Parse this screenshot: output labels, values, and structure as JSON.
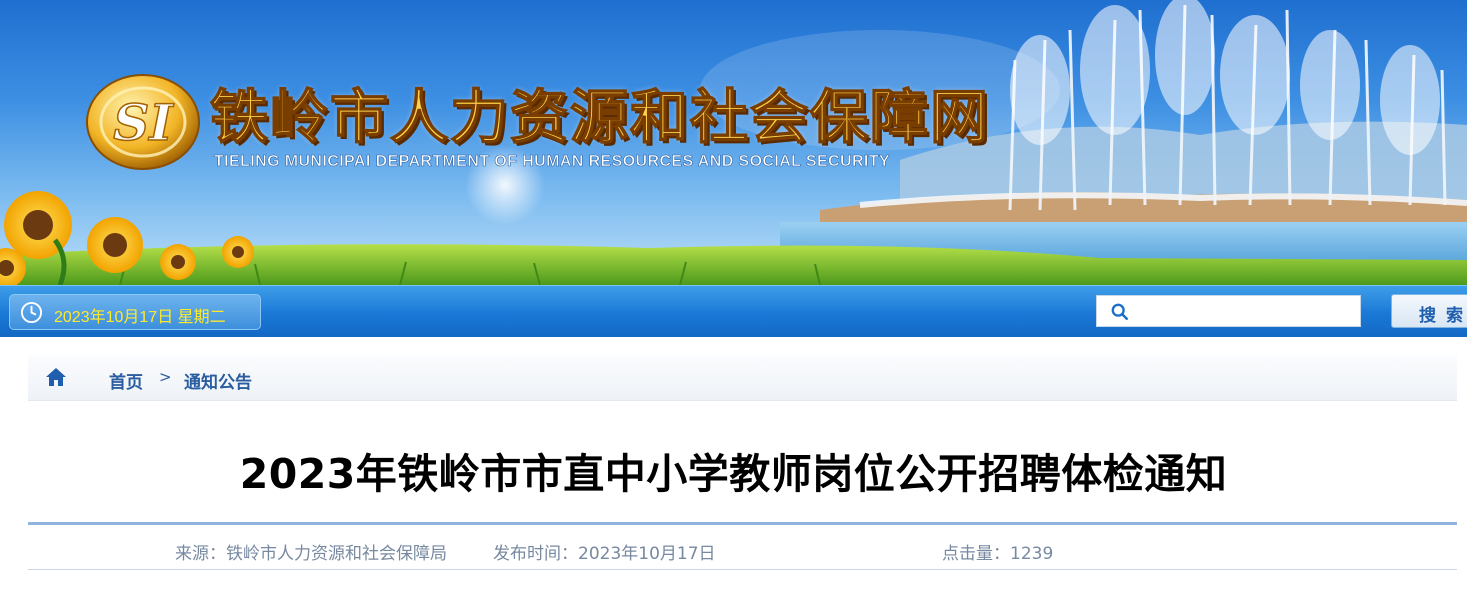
{
  "header": {
    "site_title": "铁岭市人力资源和社会保障网",
    "site_subtitle": "TIELING MUNICIPAI DEPARTMENT OF HUMAN RESOURCES AND SOCIAL SECURITY",
    "logo_text": "SI",
    "icons": {
      "logo": "si-emblem-icon"
    }
  },
  "toolbar": {
    "date_text": "2023年10月17日 星期二",
    "search_placeholder": "",
    "search_value": "",
    "search_button_label": "搜索",
    "icons": {
      "clock": "clock-icon",
      "search": "search-icon"
    },
    "colors": {
      "bar": "#1a78d6",
      "date_text": "#ffea2a"
    }
  },
  "breadcrumb": {
    "items": [
      "首页",
      "通知公告"
    ],
    "separator": ">",
    "icons": {
      "home": "home-icon"
    },
    "color": "#2a5d9f"
  },
  "article": {
    "title": "2023年铁岭市市直中小学教师岗位公开招聘体检通知",
    "source_label": "来源：铁岭市人力资源和社会保障局",
    "publish_label": "发布时间：2023年10月17日",
    "views_label": "点击量：1239"
  }
}
